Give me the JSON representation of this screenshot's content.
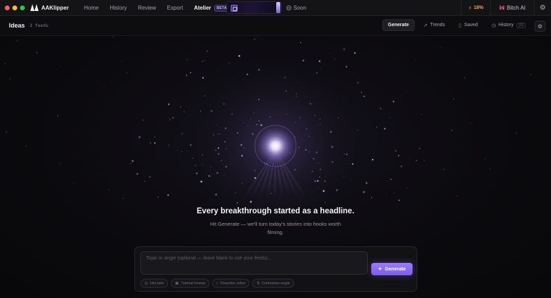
{
  "app": {
    "name": "AAKlipper"
  },
  "nav": {
    "items": [
      {
        "label": "Home"
      },
      {
        "label": "History"
      },
      {
        "label": "Review"
      },
      {
        "label": "Export"
      },
      {
        "label": "Atelier",
        "badge": "BETA",
        "active": true
      }
    ],
    "soon_label": "Soon"
  },
  "status": {
    "credits": "18%",
    "brand_ai": "Bitch AI"
  },
  "subheader": {
    "title": "Ideas",
    "feeds": "3 feeds",
    "tabs": [
      {
        "label": "Generate",
        "icon": "",
        "active": true
      },
      {
        "label": "Trends",
        "icon": "trend-icon"
      },
      {
        "label": "Saved",
        "icon": "bookmark-icon"
      },
      {
        "label": "History",
        "icon": "clock-icon",
        "shortcut": "(3)"
      }
    ]
  },
  "hero": {
    "headline": "Every breakthrough started as a headline.",
    "subline": "Hit Generate — we'll turn today's stories into hooks worth filming."
  },
  "composer": {
    "placeholder": "Topic or angle (optional — leave blank to use your feeds)...",
    "value": "",
    "generate_label": "Generate",
    "chips": [
      {
        "label": "Hot take"
      },
      {
        "label": "Tutorial format"
      },
      {
        "label": "Reaction video"
      },
      {
        "label": "Contrarian angle"
      }
    ]
  },
  "colors": {
    "accent": "#8b6cff",
    "credits": "#f2a93b",
    "brand": "#e0537a"
  }
}
